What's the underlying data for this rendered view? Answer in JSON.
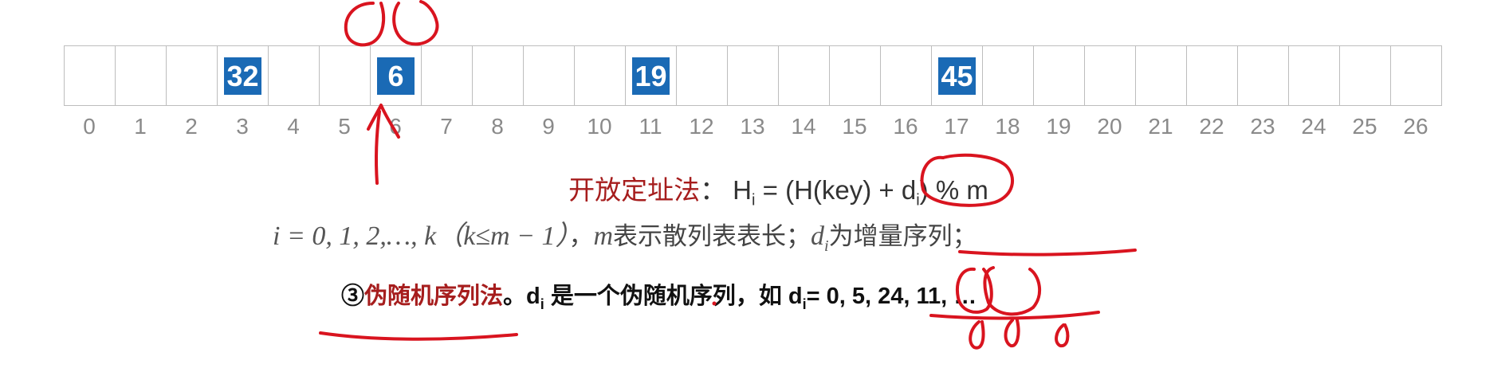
{
  "table": {
    "cells": [
      {
        "index": "0",
        "key": ""
      },
      {
        "index": "1",
        "key": ""
      },
      {
        "index": "2",
        "key": ""
      },
      {
        "index": "3",
        "key": "32"
      },
      {
        "index": "4",
        "key": ""
      },
      {
        "index": "5",
        "key": ""
      },
      {
        "index": "6",
        "key": "6"
      },
      {
        "index": "7",
        "key": ""
      },
      {
        "index": "8",
        "key": ""
      },
      {
        "index": "9",
        "key": ""
      },
      {
        "index": "10",
        "key": ""
      },
      {
        "index": "11",
        "key": "19"
      },
      {
        "index": "12",
        "key": ""
      },
      {
        "index": "13",
        "key": ""
      },
      {
        "index": "14",
        "key": ""
      },
      {
        "index": "15",
        "key": ""
      },
      {
        "index": "16",
        "key": ""
      },
      {
        "index": "17",
        "key": "45"
      },
      {
        "index": "18",
        "key": ""
      },
      {
        "index": "19",
        "key": ""
      },
      {
        "index": "20",
        "key": ""
      },
      {
        "index": "21",
        "key": ""
      },
      {
        "index": "22",
        "key": ""
      },
      {
        "index": "23",
        "key": ""
      },
      {
        "index": "24",
        "key": ""
      },
      {
        "index": "25",
        "key": ""
      },
      {
        "index": "26",
        "key": ""
      }
    ],
    "key_color": "#1a6ab5"
  },
  "formula": {
    "method_label": "开放定址法",
    "colon": "：",
    "expr_head": "H",
    "expr_sub": "i",
    "expr_mid": " = (H(key) + d",
    "expr_mid_sub": "i",
    "expr_tail": ") % m"
  },
  "condition": {
    "range": "i = 0, 1, 2,…, k",
    "k_paren": "（k≤m − 1）",
    "sep": "，",
    "m": "m",
    "m_desc": "表示散列表表长；",
    "d": "d",
    "d_sub": "i",
    "d_desc": "为增量序列；"
  },
  "method3": {
    "circled": "③",
    "name": "伪随机序列法",
    "period": "。",
    "d": "d",
    "d_sub": "i",
    "desc": " 是一个伪随机序列，如 ",
    "d2": "d",
    "d2_sub": "i",
    "values": "= 0, 5, 24, 11, …"
  },
  "colors": {
    "accent_red": "#a61d1d",
    "ink_red": "#d9141f"
  }
}
